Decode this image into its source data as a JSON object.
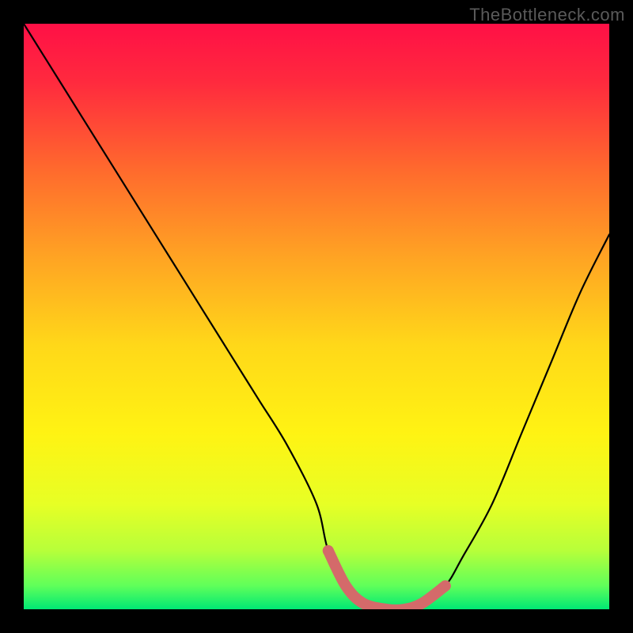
{
  "watermark": "TheBottleneck.com",
  "chart_data": {
    "type": "line",
    "title": "",
    "xlabel": "",
    "ylabel": "",
    "xlim": [
      0,
      100
    ],
    "ylim": [
      0,
      100
    ],
    "series": [
      {
        "name": "bottleneck-curve",
        "x": [
          0,
          5,
          10,
          15,
          20,
          25,
          30,
          35,
          40,
          45,
          50,
          52,
          55,
          58,
          62,
          65,
          68,
          72,
          75,
          80,
          85,
          90,
          95,
          100
        ],
        "y": [
          100,
          92,
          84,
          76,
          68,
          60,
          52,
          44,
          36,
          28,
          18,
          10,
          4,
          1,
          0,
          0,
          1,
          4,
          9,
          18,
          30,
          42,
          54,
          64
        ]
      }
    ],
    "highlight": {
      "x_range": [
        52,
        72
      ],
      "color": "#d46a6a"
    },
    "background_gradient": {
      "stops": [
        {
          "pos": 0.0,
          "color": "#ff1046"
        },
        {
          "pos": 0.1,
          "color": "#ff2a3e"
        },
        {
          "pos": 0.25,
          "color": "#ff6a2d"
        },
        {
          "pos": 0.4,
          "color": "#ffa423"
        },
        {
          "pos": 0.55,
          "color": "#ffd819"
        },
        {
          "pos": 0.7,
          "color": "#fff313"
        },
        {
          "pos": 0.82,
          "color": "#e7ff25"
        },
        {
          "pos": 0.9,
          "color": "#b7ff3a"
        },
        {
          "pos": 0.96,
          "color": "#5fff5a"
        },
        {
          "pos": 1.0,
          "color": "#00e874"
        }
      ]
    }
  }
}
